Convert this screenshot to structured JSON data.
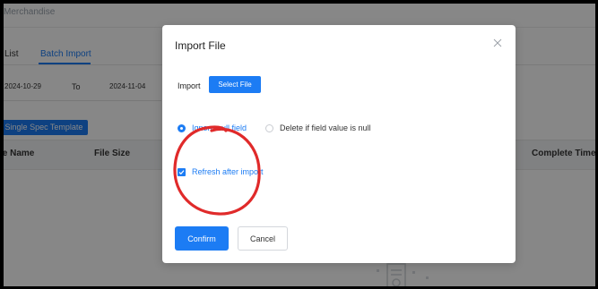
{
  "background": {
    "title": "Merchandise",
    "tabs": [
      {
        "label": "List"
      },
      {
        "label": "Batch Import"
      }
    ],
    "date_start": "2024-10-29",
    "date_to_label": "To",
    "date_end": "2024-11-04",
    "template_button": "Single Spec Template",
    "columns": [
      "le Name",
      "File Size",
      "Complete Time"
    ]
  },
  "modal": {
    "title": "Import File",
    "import_label": "Import",
    "select_file_button": "Select File",
    "radio_options": [
      {
        "label": "Ignore null field",
        "checked": true
      },
      {
        "label": "Delete if field value is null",
        "checked": false
      }
    ],
    "refresh_checkbox": {
      "label": "Refresh after import",
      "checked": true
    },
    "confirm_button": "Confirm",
    "cancel_button": "Cancel"
  },
  "icons": {
    "close": "close-icon",
    "checkmark": "checkmark-icon",
    "empty_state": "empty-box-icon"
  },
  "colors": {
    "accent": "#1c7cf4",
    "annotation": "#e02a2a"
  }
}
